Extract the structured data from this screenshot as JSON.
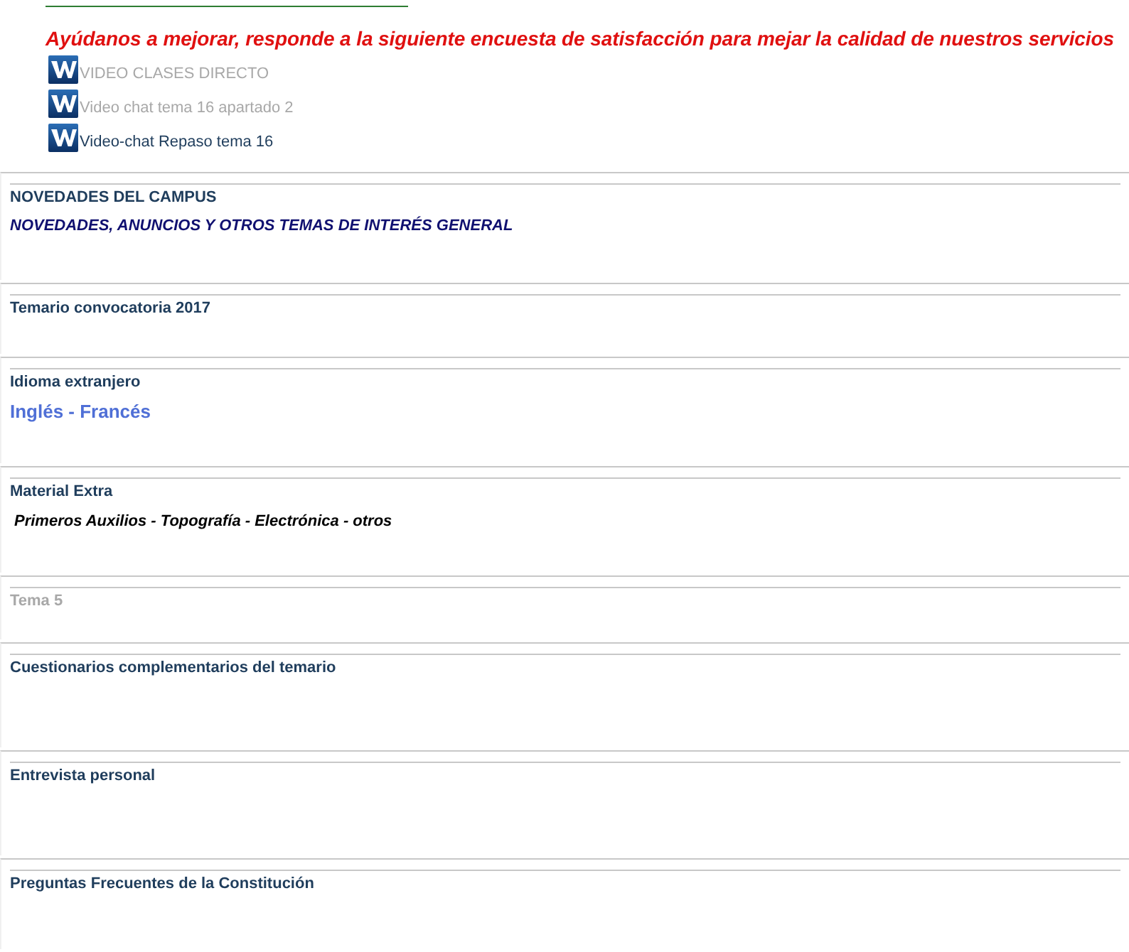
{
  "survey_banner": "Ayúdanos a mejorar, responde a la siguiente encuesta de satisfacción para mejar la calidad de nuestros servicios",
  "resources": [
    {
      "label": "VIDEO CLASES DIRECTO",
      "dimmed": true
    },
    {
      "label": "Video chat tema 16 apartado 2",
      "dimmed": true
    },
    {
      "label": "Video-chat Repaso tema 16",
      "dimmed": false
    }
  ],
  "sections": [
    {
      "title": "NOVEDADES DEL CAMPUS",
      "disabled": false,
      "subtitle": {
        "kind": "announcement",
        "text": "NOVEDADES,  ANUNCIOS Y OTROS TEMAS DE INTERÉS GENERAL"
      }
    },
    {
      "title": "Temario convocatoria 2017",
      "disabled": false
    },
    {
      "title": "Idioma extranjero",
      "disabled": false,
      "subtitle": {
        "kind": "link",
        "text": "Inglés - Francés"
      }
    },
    {
      "title": "Material Extra",
      "disabled": false,
      "subtitle": {
        "kind": "emphasis",
        "text": "Primeros Auxilios - Topografía - Electrónica - otros"
      }
    },
    {
      "title": "Tema 5",
      "disabled": true
    },
    {
      "title": "Cuestionarios complementarios del temario",
      "disabled": false
    },
    {
      "title": "Entrevista personal",
      "disabled": false
    },
    {
      "title": "Preguntas Frecuentes de la Constitución",
      "disabled": false
    }
  ]
}
